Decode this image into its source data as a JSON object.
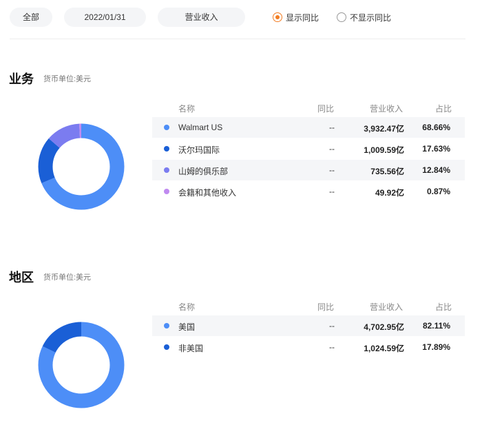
{
  "filters": {
    "scope": "全部",
    "date": "2022/01/31",
    "metric": "营业收入",
    "radio_show": "显示同比",
    "radio_hide": "不显示同比",
    "accent": "#f27c22"
  },
  "table_headers": {
    "name": "名称",
    "yoy": "同比",
    "revenue": "营业收入",
    "share": "占比"
  },
  "business": {
    "title": "业务",
    "unit": "货币单位:美元",
    "items": [
      {
        "name": "Walmart US",
        "yoy": "--",
        "revenue": "3,932.47亿",
        "share": "68.66%",
        "share_value": 68.66,
        "color": "#4d8ef7"
      },
      {
        "name": "沃尔玛国际",
        "yoy": "--",
        "revenue": "1,009.59亿",
        "share": "17.63%",
        "share_value": 17.63,
        "color": "#1a5fd6"
      },
      {
        "name": "山姆的俱乐部",
        "yoy": "--",
        "revenue": "735.56亿",
        "share": "12.84%",
        "share_value": 12.84,
        "color": "#7b7cf0"
      },
      {
        "name": "会籍和其他收入",
        "yoy": "--",
        "revenue": "49.92亿",
        "share": "0.87%",
        "share_value": 0.87,
        "color": "#c08af0"
      }
    ]
  },
  "region": {
    "title": "地区",
    "unit": "货币单位:美元",
    "items": [
      {
        "name": "美国",
        "yoy": "--",
        "revenue": "4,702.95亿",
        "share": "82.11%",
        "share_value": 82.11,
        "color": "#4d8ef7"
      },
      {
        "name": "非美国",
        "yoy": "--",
        "revenue": "1,024.59亿",
        "share": "17.89%",
        "share_value": 17.89,
        "color": "#1a5fd6"
      }
    ]
  }
}
